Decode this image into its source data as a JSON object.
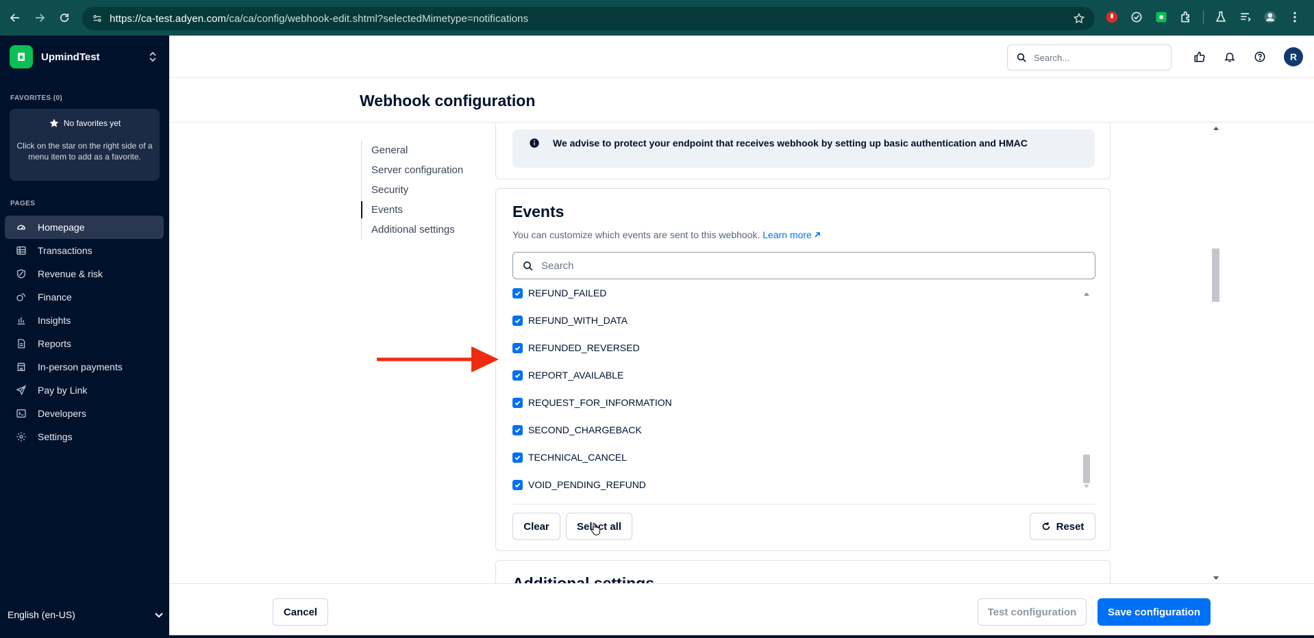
{
  "browser": {
    "url_host": "https://ca-test.adyen.com",
    "url_path": "/ca/ca/config/webhook-edit.shtml?selectedMimetype=notifications"
  },
  "sidebar": {
    "account_name": "UpmindTest",
    "favorites_label": "FAVORITES (0)",
    "favorites_title": "No favorites yet",
    "favorites_desc": "Click on the star on the right side of a menu item to add as a favorite.",
    "pages_label": "PAGES",
    "items": [
      {
        "label": "Homepage",
        "icon": "home-icon"
      },
      {
        "label": "Transactions",
        "icon": "table-icon"
      },
      {
        "label": "Revenue & risk",
        "icon": "shield-icon"
      },
      {
        "label": "Finance",
        "icon": "finance-icon"
      },
      {
        "label": "Insights",
        "icon": "bar-chart-icon"
      },
      {
        "label": "Reports",
        "icon": "document-icon"
      },
      {
        "label": "In-person payments",
        "icon": "store-icon"
      },
      {
        "label": "Pay by Link",
        "icon": "send-icon"
      },
      {
        "label": "Developers",
        "icon": "terminal-icon"
      },
      {
        "label": "Settings",
        "icon": "gear-icon"
      }
    ],
    "language": "English (en-US)"
  },
  "header": {
    "search_placeholder": "Search...",
    "avatar_initial": "R"
  },
  "page": {
    "title": "Webhook configuration",
    "anchors": [
      "General",
      "Server configuration",
      "Security",
      "Events",
      "Additional settings"
    ],
    "active_anchor": "Events"
  },
  "alert": {
    "text": "We advise to protect your endpoint that receives webhook by setting up basic authentication and HMAC"
  },
  "events": {
    "title": "Events",
    "description": "You can customize which events are sent to this webhook.",
    "learn_more": "Learn more",
    "search_placeholder": "Search",
    "items": [
      {
        "label": "REFUND_FAILED",
        "checked": true
      },
      {
        "label": "REFUND_WITH_DATA",
        "checked": true
      },
      {
        "label": "REFUNDED_REVERSED",
        "checked": true
      },
      {
        "label": "REPORT_AVAILABLE",
        "checked": true
      },
      {
        "label": "REQUEST_FOR_INFORMATION",
        "checked": true
      },
      {
        "label": "SECOND_CHARGEBACK",
        "checked": true
      },
      {
        "label": "TECHNICAL_CANCEL",
        "checked": true
      },
      {
        "label": "VOID_PENDING_REFUND",
        "checked": true
      }
    ],
    "clear_label": "Clear",
    "select_all_label": "Select all",
    "reset_label": "Reset"
  },
  "additional": {
    "title": "Additional settings"
  },
  "footer": {
    "cancel_label": "Cancel",
    "test_label": "Test configuration",
    "save_label": "Save configuration"
  },
  "colors": {
    "sidebar_bg": "#00112c",
    "accent": "#0070f5",
    "brand_green": "#0abf53",
    "annotation_red": "#ee2b10"
  }
}
